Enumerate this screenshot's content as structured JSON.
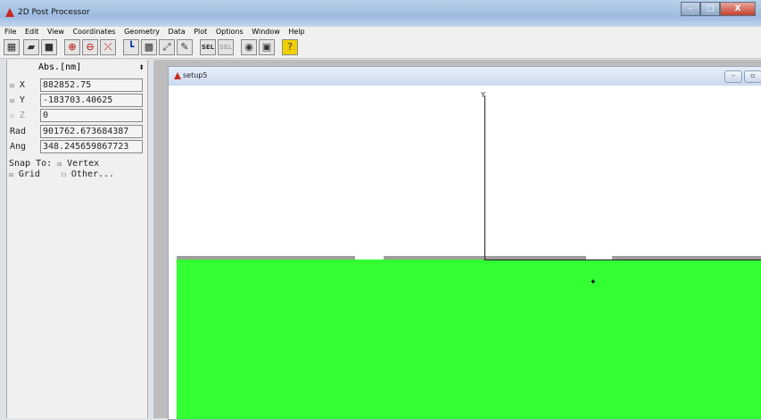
{
  "app": {
    "title": "2D Post Processor",
    "controls": {
      "min": "–",
      "max": "□",
      "close": "X"
    }
  },
  "menu": [
    "File",
    "Edit",
    "View",
    "Coordinates",
    "Geometry",
    "Data",
    "Plot",
    "Options",
    "Window",
    "Help"
  ],
  "toolbar": {
    "sel_label": "SEL",
    "sel2_label": "SEL",
    "help_label": "?"
  },
  "left": {
    "units": "Abs.[nm]",
    "units_arrow": "⬍",
    "fields": {
      "x": {
        "label": "X",
        "value": "882852.75"
      },
      "y": {
        "label": "Y",
        "value": "-183703.40625"
      },
      "z": {
        "label": "Z",
        "value": "0"
      },
      "rad": {
        "label": "Rad",
        "value": "901762.673684387"
      },
      "ang": {
        "label": "Ang",
        "value": "348.245659867723"
      }
    },
    "snap": {
      "label": "Snap To:",
      "vertex": "Vertex",
      "grid": "Grid",
      "other": "Other..."
    }
  },
  "child": {
    "title": "setup5",
    "axis_label": "Y"
  },
  "colors": {
    "accent": "#33ff33",
    "substrate": "#33ff33",
    "layer": "#9e9e9e"
  }
}
